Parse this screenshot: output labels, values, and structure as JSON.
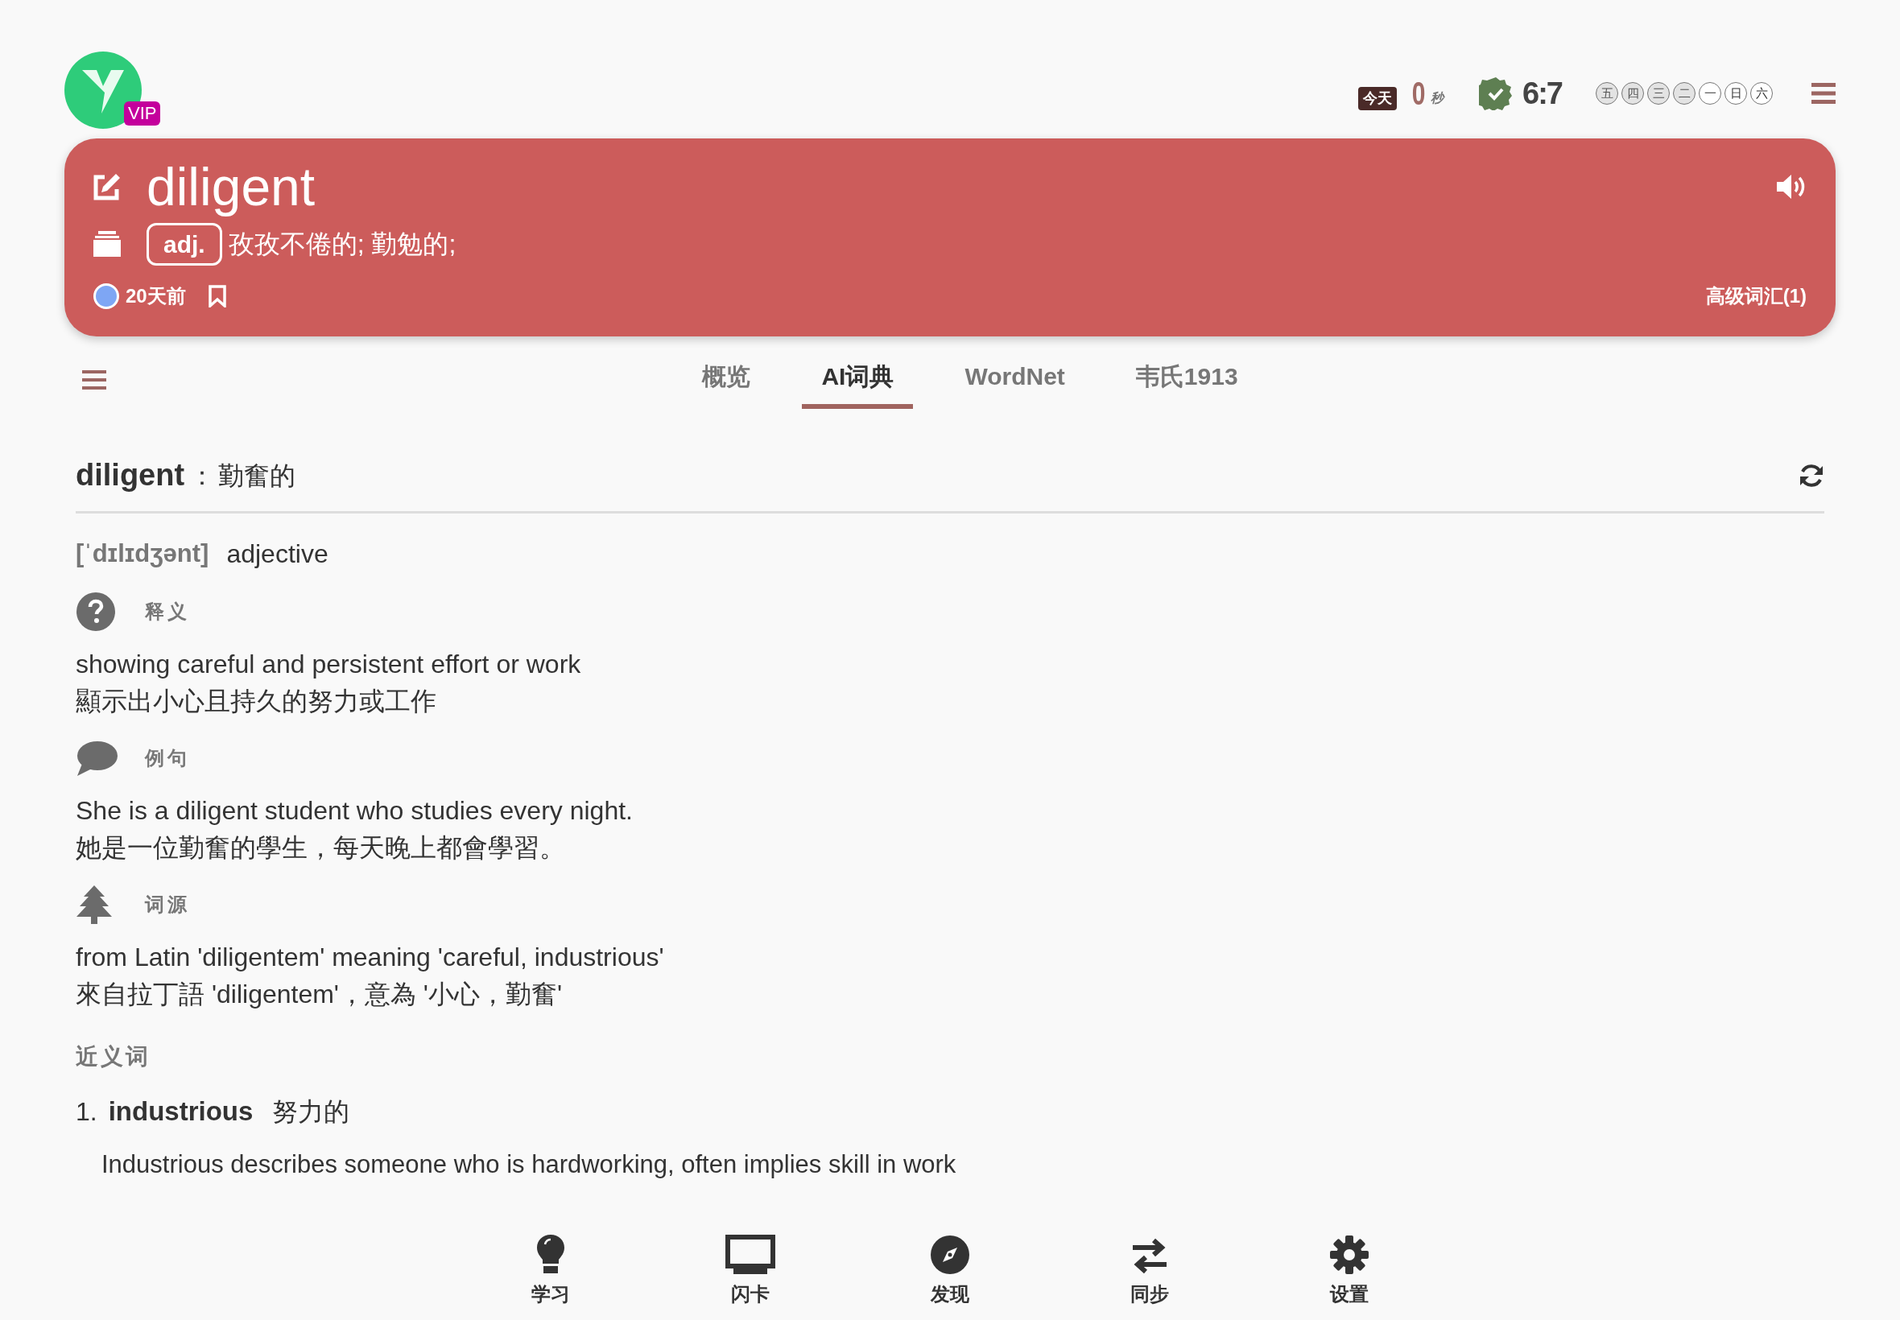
{
  "header": {
    "logo_badge": "VIP",
    "today_label": "今天",
    "today_time": "0",
    "time_unit": "秒",
    "score": "6:7",
    "weekdays": [
      {
        "label": "五",
        "done": true
      },
      {
        "label": "四",
        "done": true
      },
      {
        "label": "三",
        "done": true
      },
      {
        "label": "二",
        "done": true
      },
      {
        "label": "一",
        "done": false
      },
      {
        "label": "日",
        "done": false
      },
      {
        "label": "六",
        "done": false
      }
    ]
  },
  "word_card": {
    "word": "diligent",
    "pos": "adj.",
    "meaning": "孜孜不倦的; 勤勉的;",
    "added": "20天前",
    "bookmarked": false,
    "tag": "高级词汇(1)"
  },
  "tabs": [
    {
      "label": "概览",
      "selected": false
    },
    {
      "label": "AI词典",
      "selected": true
    },
    {
      "label": "WordNet",
      "selected": false
    },
    {
      "label": "韦氏1913",
      "selected": false
    }
  ],
  "entry": {
    "word": "diligent",
    "separator": "：",
    "translation": "勤奮的",
    "phonetic": "[ˈdɪlɪdʒənt]",
    "part_of_speech": "adjective",
    "sections": [
      {
        "kind": "definition",
        "title": "释义",
        "en": "showing careful and persistent effort or work",
        "zh": "顯示出小心且持久的努力或工作"
      },
      {
        "kind": "example",
        "title": "例句",
        "en": "She is a diligent student who studies every night.",
        "zh": "她是一位勤奮的學生，每天晚上都會學習。"
      },
      {
        "kind": "etymology",
        "title": "词源",
        "en": "from Latin 'diligentem' meaning 'careful, industrious'",
        "zh": "來自拉丁語 'diligentem'，意為 '小心，勤奮'"
      }
    ],
    "synonyms_title": "近义词",
    "synonyms": [
      {
        "number": "1.",
        "word": "industrious",
        "meaning": "努力的",
        "description": "Industrious describes someone who is hardworking, often implies skill in work"
      }
    ]
  },
  "bottom_nav": [
    {
      "kind": "learn",
      "label": "学习"
    },
    {
      "kind": "cards",
      "label": "闪卡"
    },
    {
      "kind": "discover",
      "label": "发现"
    },
    {
      "kind": "sync",
      "label": "同步"
    },
    {
      "kind": "settings",
      "label": "设置"
    }
  ]
}
